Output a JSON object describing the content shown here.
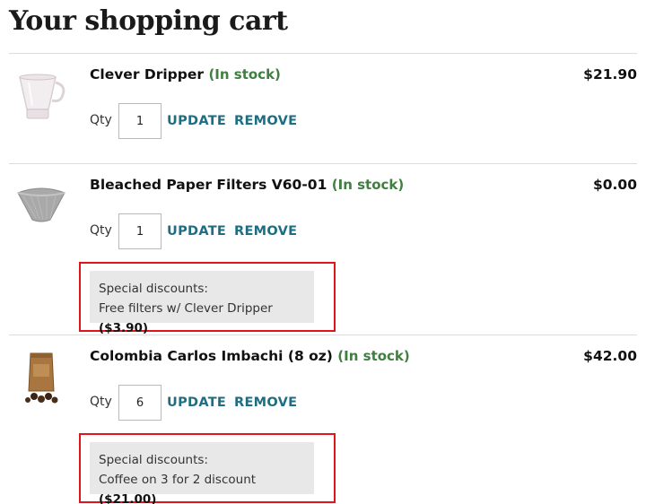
{
  "page_title": "Your shopping cart",
  "qty_label": "Qty",
  "update_label": "UPDATE",
  "remove_label": "REMOVE",
  "colors": {
    "stock": "#3f7f3f",
    "link": "#1e6e83",
    "highlight": "#e0141b"
  },
  "items": [
    {
      "name": "Clever Dripper",
      "stock": "(In stock)",
      "price": "$21.90",
      "qty": "1",
      "icon": "clever-dripper-image"
    },
    {
      "name": "Bleached Paper Filters V60-01",
      "stock": "(In stock)",
      "price": "$0.00",
      "qty": "1",
      "icon": "paper-filter-image",
      "discount": {
        "heading": "Special discounts:",
        "text": "Free filters w/ Clever Dripper",
        "amount": "($3.90)"
      }
    },
    {
      "name": "Colombia Carlos Imbachi (8 oz)",
      "stock": "(In stock)",
      "price": "$42.00",
      "qty": "6",
      "icon": "coffee-bag-image",
      "discount": {
        "heading": "Special discounts:",
        "text": "Coffee on 3 for 2 discount",
        "amount": "($21.00)"
      }
    }
  ]
}
